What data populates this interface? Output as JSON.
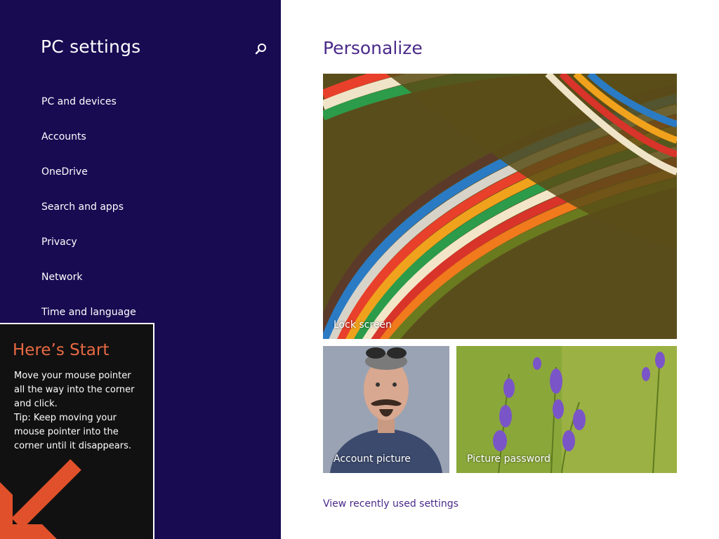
{
  "sidebar": {
    "title": "PC settings",
    "search_icon": "search-icon",
    "items": [
      {
        "label": "PC and devices"
      },
      {
        "label": "Accounts"
      },
      {
        "label": "OneDrive"
      },
      {
        "label": "Search and apps"
      },
      {
        "label": "Privacy"
      },
      {
        "label": "Network"
      },
      {
        "label": "Time and language"
      }
    ]
  },
  "main": {
    "title": "Personalize",
    "tiles": [
      {
        "label": "Lock screen"
      },
      {
        "label": "Account picture"
      },
      {
        "label": "Picture password"
      }
    ],
    "recent_link": "View recently used settings"
  },
  "start_tip": {
    "title": "Here’s Start",
    "lines": [
      "Move your mouse pointer",
      "all the way into the corner",
      "and click.",
      "Tip: Keep moving your",
      "mouse pointer into the",
      "corner until it disappears."
    ],
    "arrow_icon": "arrow-down-left-icon"
  },
  "colors": {
    "sidebar_bg": "#180b52",
    "accent": "#4a2a8a",
    "tip_title": "#e86a43",
    "tip_bg": "#111111"
  }
}
